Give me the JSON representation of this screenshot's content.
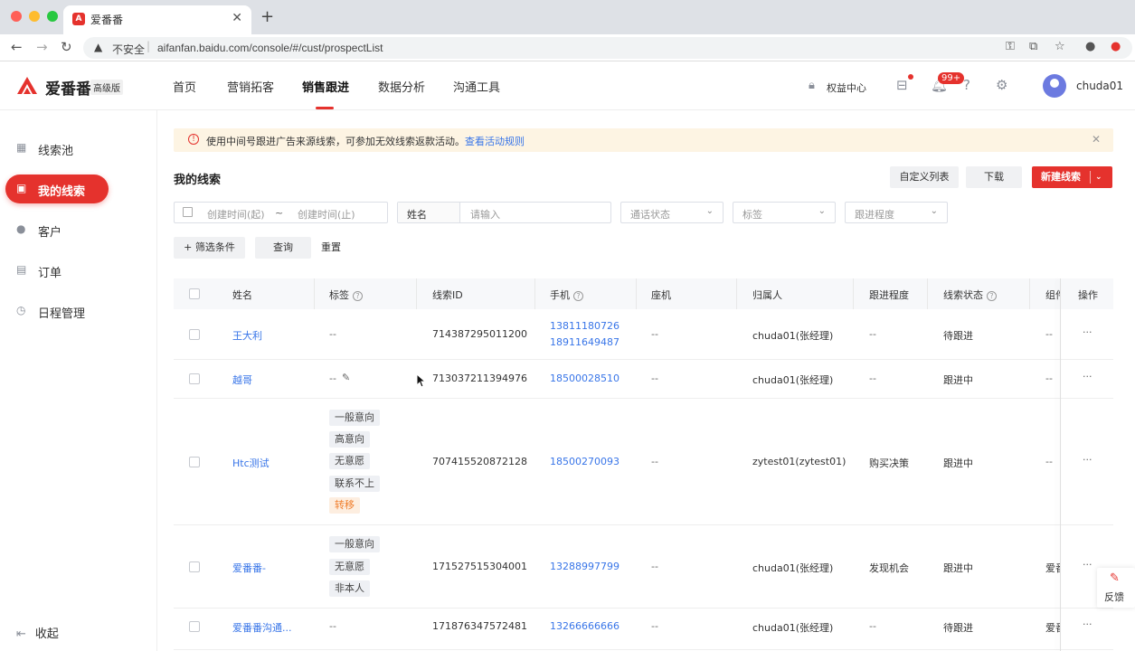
{
  "browser": {
    "tab_title": "爱番番",
    "security": "不安全",
    "url": "aifanfan.baidu.com/console/#/cust/prospectList"
  },
  "header": {
    "logo_text": "爱番番",
    "edition": "高级版",
    "nav": [
      "首页",
      "营销拓客",
      "销售跟进",
      "数据分析",
      "沟通工具"
    ],
    "active_nav": "销售跟进",
    "benefit_center": "权益中心",
    "notification_badge": "99+",
    "username": "chuda01"
  },
  "sidebar": {
    "items": [
      {
        "label": "线索池",
        "icon": "grid-icon"
      },
      {
        "label": "我的线索",
        "icon": "lead-icon"
      },
      {
        "label": "客户",
        "icon": "user-icon"
      },
      {
        "label": "订单",
        "icon": "order-icon"
      },
      {
        "label": "日程管理",
        "icon": "clock-icon"
      }
    ],
    "active": "我的线索",
    "collapse_label": "收起"
  },
  "notice": {
    "text": "使用中间号跟进广告来源线索，可参加无效线索返款活动。",
    "link": "查看活动规则"
  },
  "page": {
    "title": "我的线索",
    "buttons": {
      "custom_list": "自定义列表",
      "download": "下载",
      "new_lead": "新建线索"
    }
  },
  "filters": {
    "created_start_placeholder": "创建时间(起)",
    "range_sep": "~",
    "created_end_placeholder": "创建时间(止)",
    "name_label": "姓名",
    "name_placeholder": "请输入",
    "call_status": "通话状态",
    "tag": "标签",
    "follow_progress": "跟进程度",
    "add_condition": "+ 筛选条件",
    "query": "查询",
    "reset": "重置"
  },
  "table": {
    "columns": [
      "姓名",
      "标签",
      "线索ID",
      "手机",
      "座机",
      "归属人",
      "跟进程度",
      "线索状态",
      "组件",
      "操作"
    ],
    "rows": [
      {
        "name": "王大利",
        "tags": [
          "--"
        ],
        "id": "714387295011200",
        "phones": [
          "13811180726",
          "18911649487"
        ],
        "landline": "--",
        "owner": "chuda01(张经理)",
        "progress": "--",
        "status": "待跟进",
        "component": "--",
        "action": "···"
      },
      {
        "name": "越哥",
        "tags": [
          "--"
        ],
        "id": "713037211394976",
        "phones": [
          "18500028510"
        ],
        "landline": "--",
        "owner": "chuda01(张经理)",
        "progress": "--",
        "status": "跟进中",
        "component": "--",
        "action": "···"
      },
      {
        "name": "Htc测试",
        "tags": [
          "一般意向",
          "高意向",
          "无意愿",
          "联系不上",
          "转移"
        ],
        "id": "707415520872128",
        "phones": [
          "18500270093"
        ],
        "landline": "--",
        "owner": "zytest01(zytest01)",
        "progress": "购买决策",
        "status": "跟进中",
        "component": "--",
        "action": "···"
      },
      {
        "name": "爱番番-",
        "tags": [
          "一般意向",
          "无意愿",
          "非本人"
        ],
        "id": "171527515304001",
        "phones": [
          "13288997799"
        ],
        "landline": "--",
        "owner": "chuda01(张经理)",
        "progress": "发现机会",
        "status": "跟进中",
        "component": "爱番",
        "action": "···"
      },
      {
        "name": "爱番番沟通...",
        "tags": [
          "--"
        ],
        "id": "171876347572481",
        "phones": [
          "13266666666"
        ],
        "landline": "--",
        "owner": "chuda01(张经理)",
        "progress": "--",
        "status": "待跟进",
        "component": "爱番",
        "action": "···"
      }
    ]
  },
  "feedback_label": "反馈",
  "colors": {
    "brand": "#e5322d",
    "link": "#3875e8"
  }
}
